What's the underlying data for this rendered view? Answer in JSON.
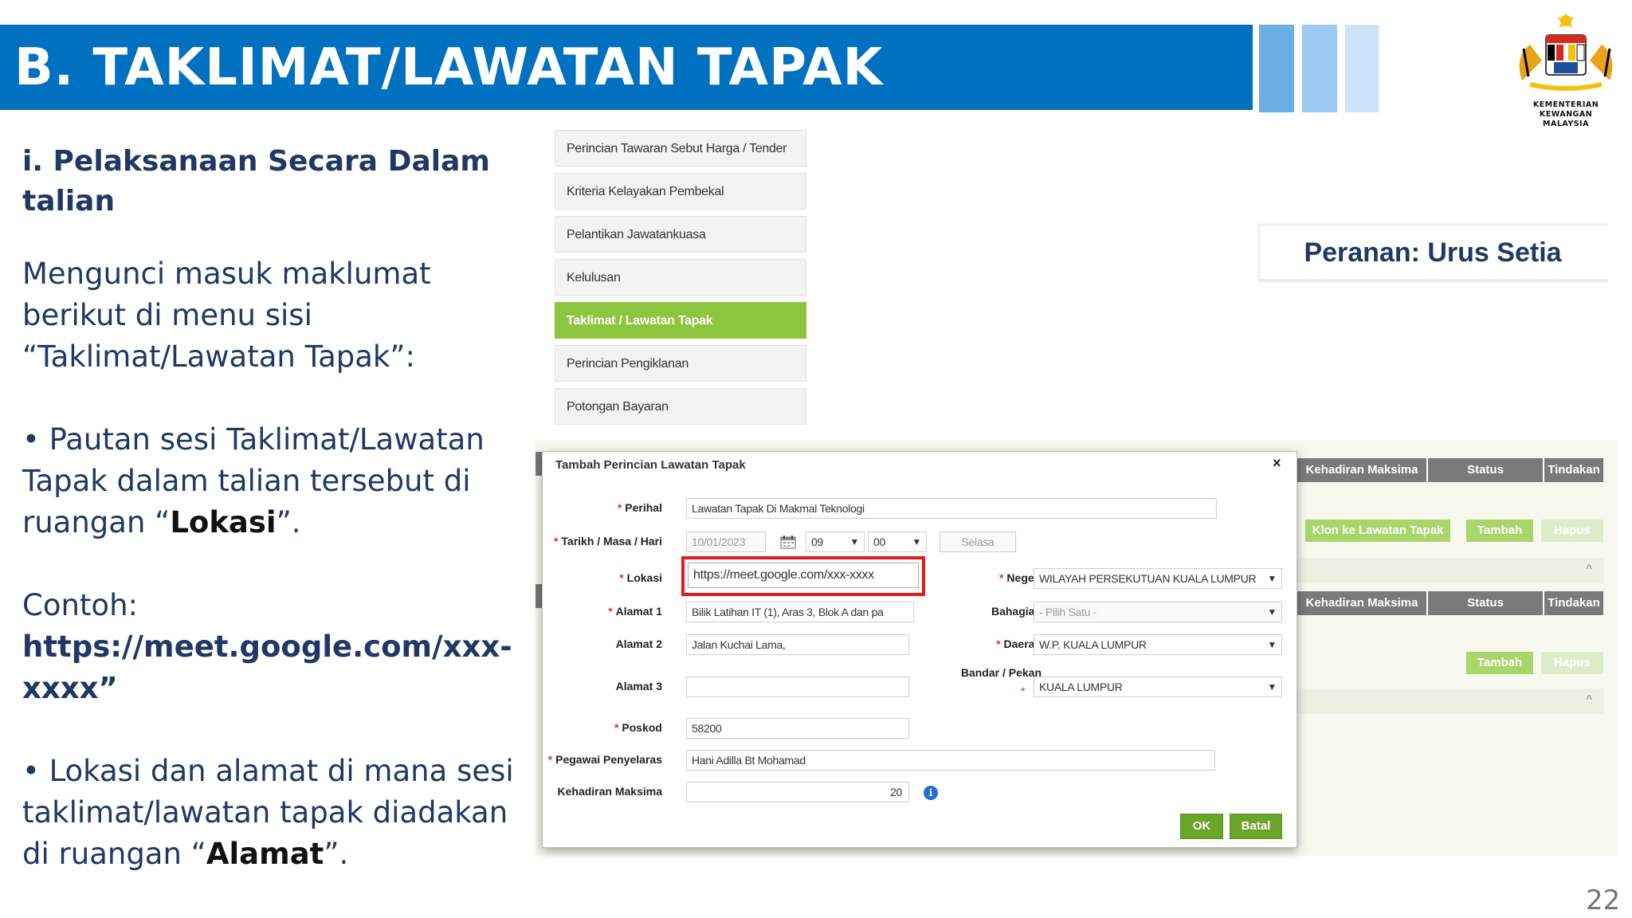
{
  "header": {
    "title": "B.  TAKLIMAT/LAWATAN TAPAK"
  },
  "crest": {
    "line1": "KEMENTERIAN KEWANGAN",
    "line2": "MALAYSIA",
    "icon": "malaysia-coat-of-arms"
  },
  "left": {
    "subtitle": "i. Pelaksanaan Secara Dalam talian",
    "para1": "Mengunci masuk maklumat berikut di menu sisi “Taklimat/Lawatan Tapak”:",
    "para2_pre": "• Pautan sesi Taklimat/Lawatan Tapak dalam talian tersebut di ruangan “",
    "para2_bold": "Lokasi",
    "para2_post": "”.",
    "example_label": "Contoh:",
    "example_link": "https://meet.google.com/xxx-xxxx”",
    "para3_pre": "• Lokasi dan alamat di mana sesi taklimat/lawatan tapak diadakan di ruangan “",
    "para3_bold": "Alamat",
    "para3_post": "”."
  },
  "menu": {
    "items": [
      {
        "label": "Perincian Tawaran Sebut Harga / Tender",
        "active": false
      },
      {
        "label": "Kriteria Kelayakan Pembekal",
        "active": false
      },
      {
        "label": "Pelantikan Jawatankuasa",
        "active": false
      },
      {
        "label": "Kelulusan",
        "active": false
      },
      {
        "label": "Taklimat / Lawatan Tapak",
        "active": true
      },
      {
        "label": "Perincian Pengiklanan",
        "active": false
      },
      {
        "label": "Potongan Bayaran",
        "active": false
      }
    ]
  },
  "role": {
    "text": "Peranan: Urus Setia"
  },
  "bg_table": {
    "col1": "Kehadiran Maksima",
    "col2": "Status",
    "col3": "Tindakan",
    "btn_clone": "Klon ke Lawatan Tapak",
    "btn_add": "Tambah",
    "btn_delete": "Hapus",
    "collapse_icon": "^"
  },
  "modal": {
    "title": "Tambah Perincian Lawatan Tapak",
    "close": "×",
    "required_mark": "*",
    "labels": {
      "perihal": "Perihal",
      "tarikh": "Tarikh / Masa / Hari",
      "lokasi": "Lokasi",
      "alamat1": "Alamat 1",
      "alamat2": "Alamat 2",
      "alamat3": "Alamat 3",
      "poskod": "Poskod",
      "pegawai": "Pegawai Penyelaras",
      "kehadiran": "Kehadiran Maksima",
      "negeri": "Negeri",
      "bahagian": "Bahagian",
      "daerah": "Daerah",
      "bandar": "Bandar / Pekan"
    },
    "values": {
      "perihal": "Lawatan Tapak Di Makmal Teknologi",
      "tarikh": "10/01/2023",
      "jam": "09",
      "minit": "00",
      "hari": "Selasa",
      "lokasi": "https://meet.google.com/xxx-xxxx",
      "alamat1": "Bilik Latihan IT (1), Aras 3, Blok A dan pa",
      "alamat2": "Jalan Kuchai Lama,",
      "alamat3": "",
      "poskod": "58200",
      "pegawai": "Hani Adilla Bt Mohamad",
      "kehadiran": "20",
      "negeri": "WILAYAH PERSEKUTUAN KUALA LUMPUR",
      "bahagian": "- Pilih Satu -",
      "daerah": "W.P. KUALA LUMPUR",
      "bandar": "KUALA LUMPUR"
    },
    "buttons": {
      "ok": "OK",
      "cancel": "Batal"
    },
    "info_icon": "i"
  },
  "page_number": "22",
  "colors": {
    "header_blue": "#0070c0",
    "text_navy": "#203864",
    "menu_active": "#8cc63f",
    "ok_green": "#6aa52a",
    "highlight_red": "#e31b1b"
  }
}
